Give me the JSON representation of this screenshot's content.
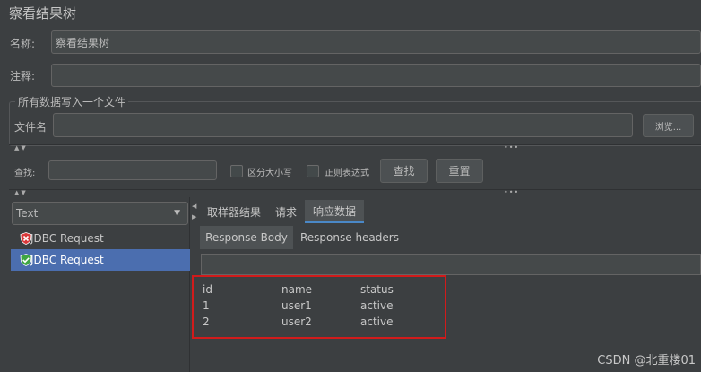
{
  "window": {
    "title": "察看结果树"
  },
  "form": {
    "name_label": "名称:",
    "name_value": "察看结果树",
    "comment_label": "注释:",
    "comment_value": "",
    "file_group_title": "所有数据写入一个文件",
    "filename_label": "文件名",
    "filename_value": "",
    "browse_label": "浏览..."
  },
  "search": {
    "label": "查找:",
    "value": "",
    "case_sensitive_label": "区分大小写",
    "case_sensitive_checked": false,
    "regex_label": "正则表达式",
    "regex_checked": false,
    "find_button": "查找",
    "reset_button": "重置"
  },
  "left": {
    "renderer_select": "Text",
    "tree_items": [
      {
        "label": "JDBC Request",
        "status": "error",
        "selected": false
      },
      {
        "label": "JDBC Request",
        "status": "success",
        "selected": true
      }
    ]
  },
  "tabs": [
    {
      "label": "取样器结果",
      "active": false
    },
    {
      "label": "请求",
      "active": false
    },
    {
      "label": "响应数据",
      "active": true
    }
  ],
  "subtabs": [
    {
      "label": "Response Body",
      "active": true
    },
    {
      "label": "Response headers",
      "active": false
    }
  ],
  "response_table": {
    "headers": [
      "id",
      "name",
      "status"
    ],
    "rows": [
      [
        "1",
        "user1",
        "active"
      ],
      [
        "2",
        "user2",
        "active"
      ]
    ]
  },
  "watermark": "CSDN @北重楼01",
  "colors": {
    "selection": "#4b6eaf",
    "highlight_box": "#d11b1b",
    "error_icon": "#d9383a",
    "success_icon": "#3fa643"
  }
}
